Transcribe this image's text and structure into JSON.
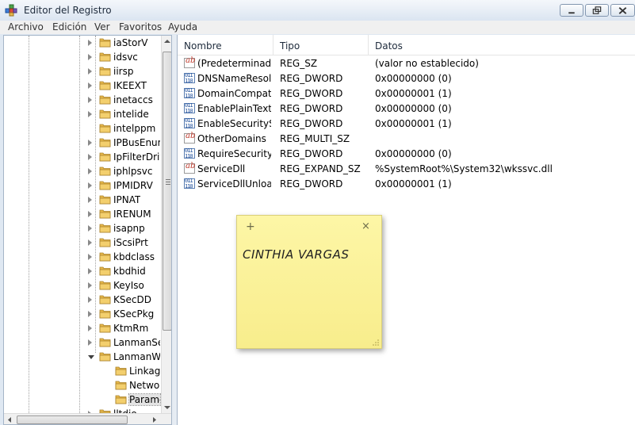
{
  "window": {
    "title": "Editor del Registro",
    "icon": "registry-editor-icon"
  },
  "menu": [
    "Archivo",
    "Edición",
    "Ver",
    "Favoritos",
    "Ayuda"
  ],
  "tree": {
    "items": [
      {
        "label": "iaStorV",
        "state": "collapsed",
        "level": 0
      },
      {
        "label": "idsvc",
        "state": "collapsed",
        "level": 0
      },
      {
        "label": "iirsp",
        "state": "collapsed",
        "level": 0
      },
      {
        "label": "IKEEXT",
        "state": "collapsed",
        "level": 0
      },
      {
        "label": "inetaccs",
        "state": "collapsed",
        "level": 0
      },
      {
        "label": "intelide",
        "state": "collapsed",
        "level": 0
      },
      {
        "label": "intelppm",
        "state": "none",
        "level": 0
      },
      {
        "label": "IPBusEnum",
        "state": "collapsed",
        "level": 0
      },
      {
        "label": "IpFilterDriv",
        "state": "collapsed",
        "level": 0
      },
      {
        "label": "iphlpsvc",
        "state": "collapsed",
        "level": 0
      },
      {
        "label": "IPMIDRV",
        "state": "collapsed",
        "level": 0
      },
      {
        "label": "IPNAT",
        "state": "collapsed",
        "level": 0
      },
      {
        "label": "IRENUM",
        "state": "collapsed",
        "level": 0
      },
      {
        "label": "isapnp",
        "state": "collapsed",
        "level": 0
      },
      {
        "label": "iScsiPrt",
        "state": "collapsed",
        "level": 0
      },
      {
        "label": "kbdclass",
        "state": "collapsed",
        "level": 0
      },
      {
        "label": "kbdhid",
        "state": "collapsed",
        "level": 0
      },
      {
        "label": "KeyIso",
        "state": "collapsed",
        "level": 0
      },
      {
        "label": "KSecDD",
        "state": "collapsed",
        "level": 0
      },
      {
        "label": "KSecPkg",
        "state": "collapsed",
        "level": 0
      },
      {
        "label": "KtmRm",
        "state": "collapsed",
        "level": 0
      },
      {
        "label": "LanmanServer",
        "state": "collapsed",
        "level": 0
      },
      {
        "label": "LanmanWorkstation",
        "state": "expanded",
        "level": 0
      },
      {
        "label": "Linkage",
        "state": "none",
        "level": 1
      },
      {
        "label": "NetworkProvider",
        "state": "none",
        "level": 1
      },
      {
        "label": "Parameters",
        "state": "none",
        "level": 1,
        "selected": true
      },
      {
        "label": "lltdio",
        "state": "collapsed",
        "level": 0
      }
    ]
  },
  "list": {
    "columns": [
      "Nombre",
      "Tipo",
      "Datos"
    ],
    "rows": [
      {
        "icon": "string-value-icon",
        "name": "(Predeterminado)",
        "type": "REG_SZ",
        "data": "(valor no establecido)"
      },
      {
        "icon": "dword-value-icon",
        "name": "DNSNameResolutionRequired",
        "type": "REG_DWORD",
        "data": "0x00000000 (0)"
      },
      {
        "icon": "dword-value-icon",
        "name": "DomainCompatibilityMode",
        "type": "REG_DWORD",
        "data": "0x00000001 (1)"
      },
      {
        "icon": "dword-value-icon",
        "name": "EnablePlainTextPassword",
        "type": "REG_DWORD",
        "data": "0x00000000 (0)"
      },
      {
        "icon": "dword-value-icon",
        "name": "EnableSecuritySignature",
        "type": "REG_DWORD",
        "data": "0x00000001 (1)"
      },
      {
        "icon": "string-value-icon",
        "name": "OtherDomains",
        "type": "REG_MULTI_SZ",
        "data": ""
      },
      {
        "icon": "dword-value-icon",
        "name": "RequireSecuritySignature",
        "type": "REG_DWORD",
        "data": "0x00000000 (0)"
      },
      {
        "icon": "string-value-icon",
        "name": "ServiceDll",
        "type": "REG_EXPAND_SZ",
        "data": "%SystemRoot%\\System32\\wkssvc.dll"
      },
      {
        "icon": "dword-value-icon",
        "name": "ServiceDllUnloadOnStop",
        "type": "REG_DWORD",
        "data": "0x00000001 (1)"
      }
    ]
  },
  "sticky_note": {
    "text": "CINTHIA VARGAS",
    "add_label": "+",
    "close_label": "×"
  },
  "colors": {
    "folder": "#e8b84a",
    "sticky": "#fdf6a6",
    "accent": "#1f4f9a"
  }
}
